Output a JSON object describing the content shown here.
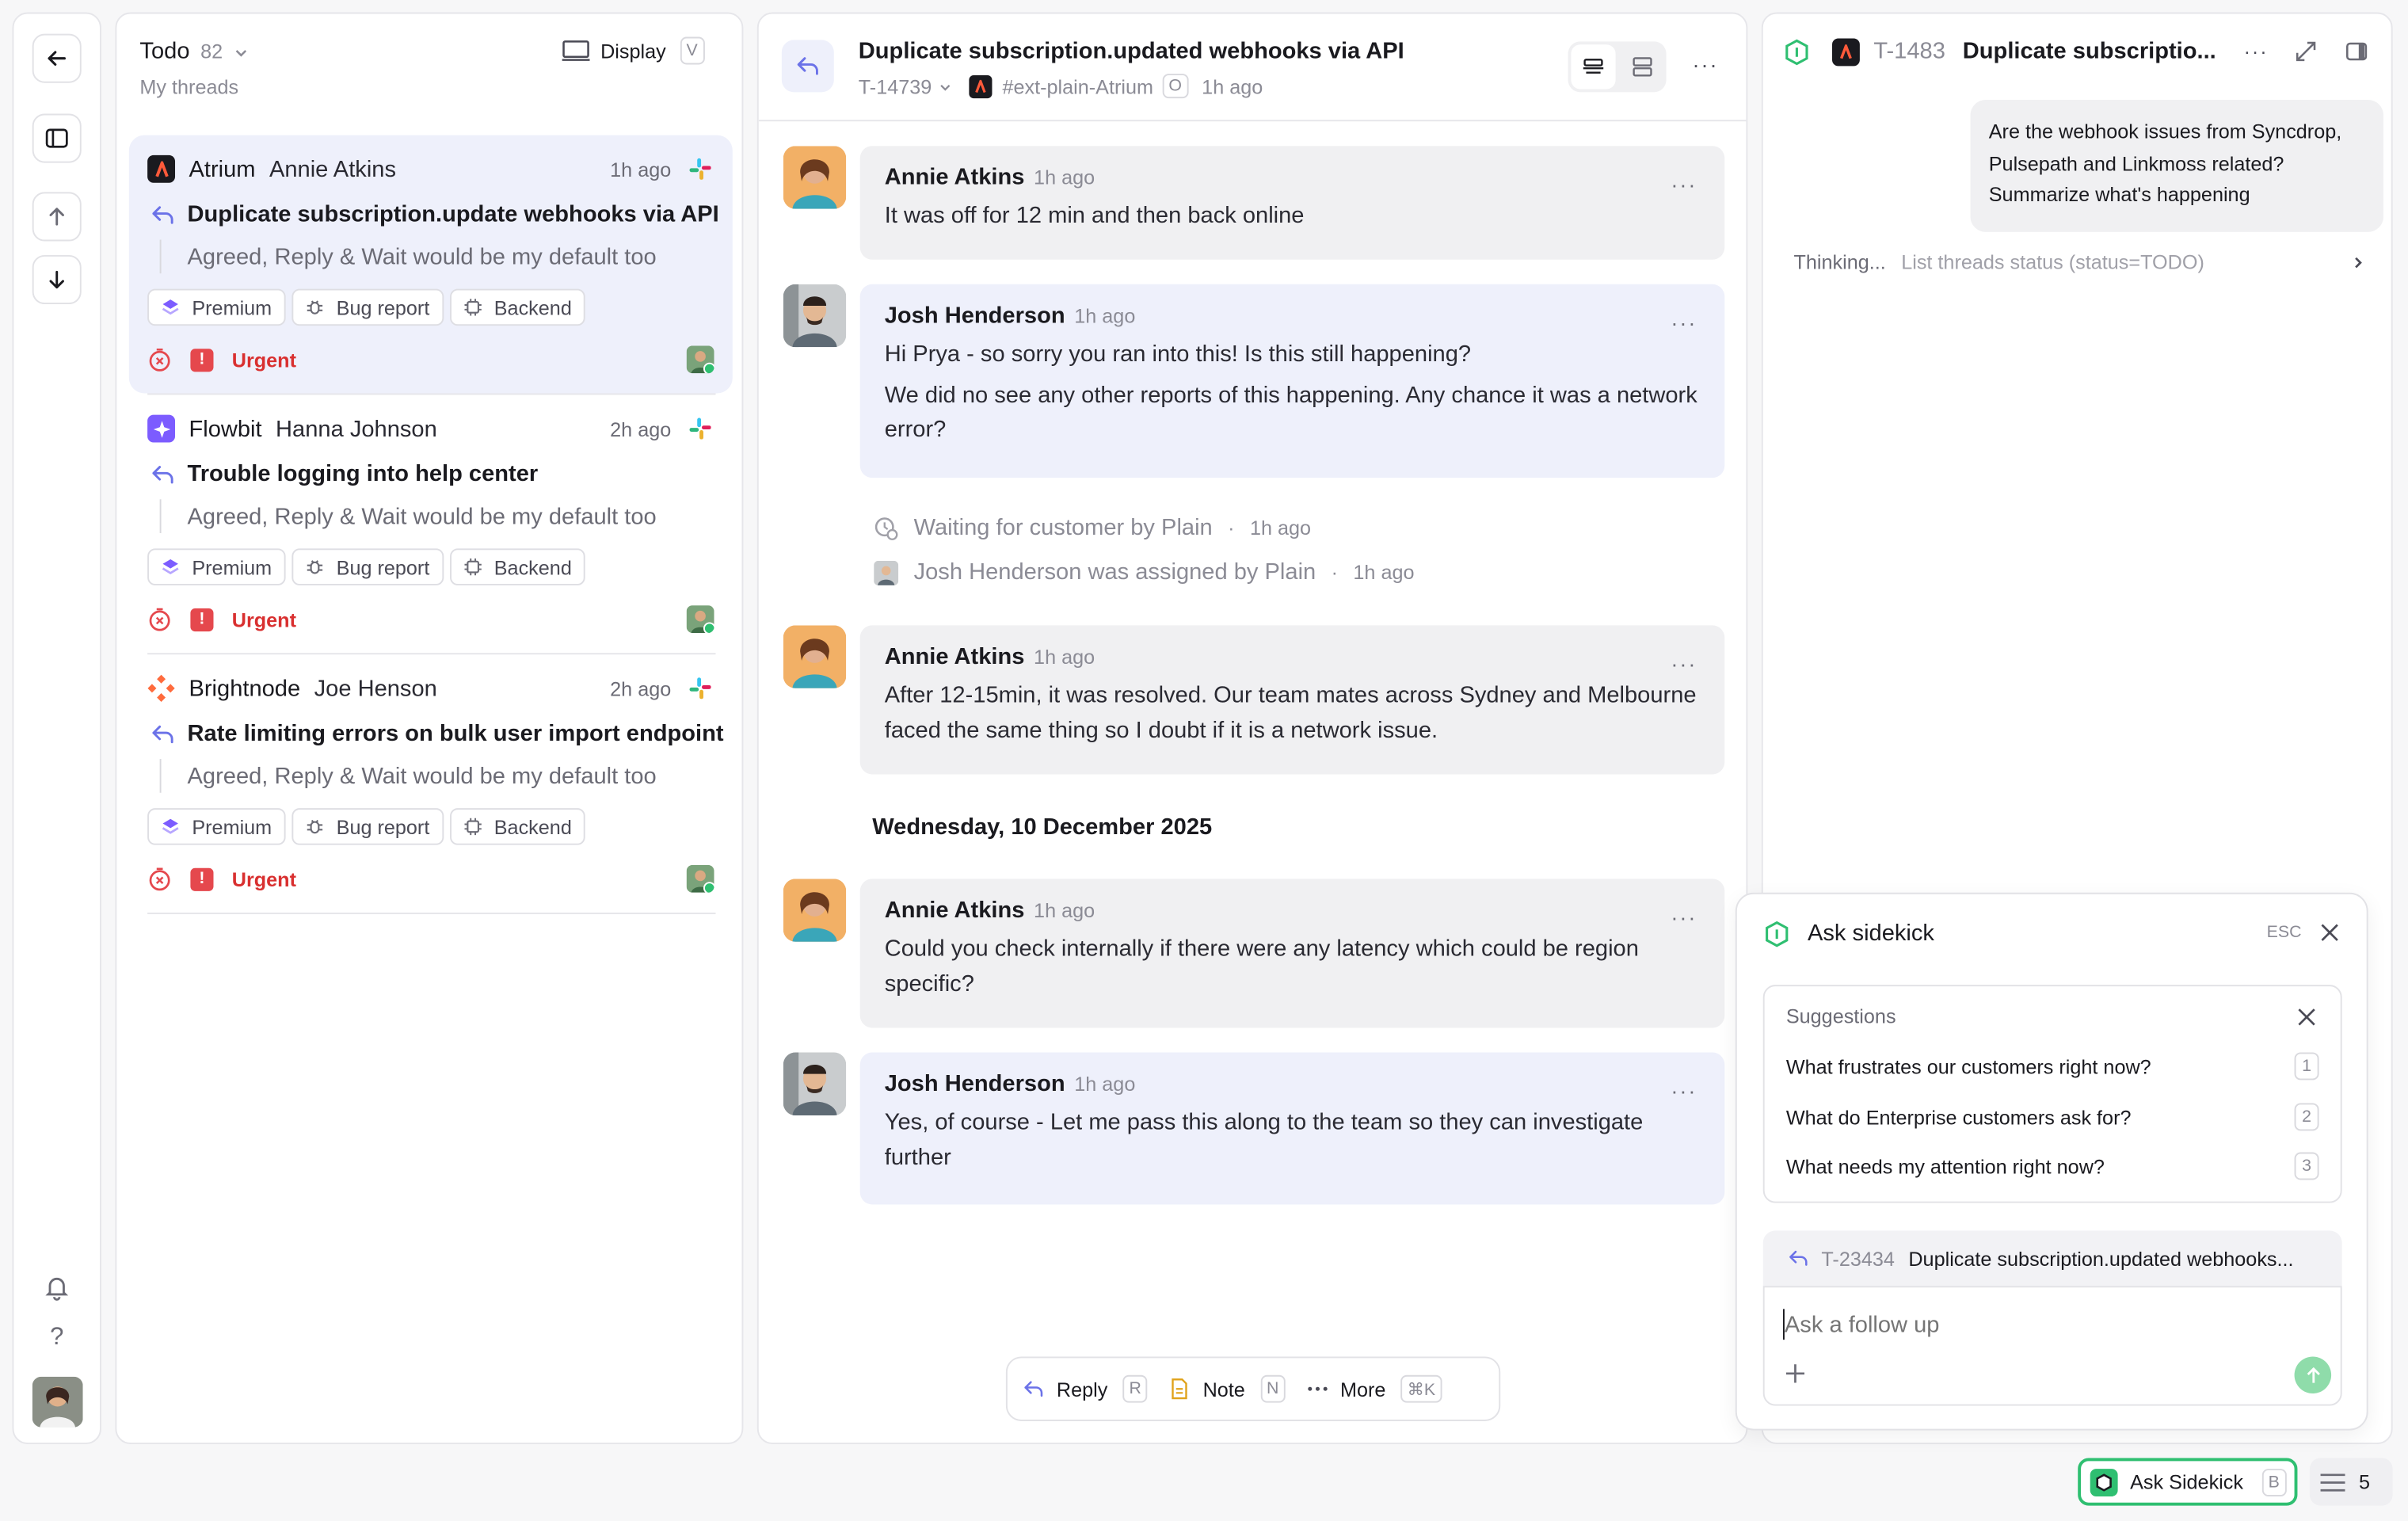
{
  "rail": {
    "back_icon": "arrow-left-icon",
    "layout_icon": "sidebar-icon",
    "up_icon": "arrow-up-icon",
    "down_icon": "arrow-down-icon",
    "help": "?"
  },
  "list": {
    "title": "Todo",
    "count": "82",
    "subtitle": "My threads",
    "display_label": "Display",
    "display_key": "V",
    "threads": [
      {
        "company": "Atrium",
        "person": "Annie Atkins",
        "time": "1h ago",
        "title": "Duplicate subscription.update webhooks via API",
        "preview": "Agreed, Reply & Wait would be my default too",
        "tags": [
          "Premium",
          "Bug report",
          "Backend"
        ],
        "priority": "Urgent",
        "priority_mark": "!"
      },
      {
        "company": "Flowbit",
        "person": "Hanna Johnson",
        "time": "2h ago",
        "title": "Trouble logging into help center",
        "preview": "Agreed, Reply & Wait would be my default too",
        "tags": [
          "Premium",
          "Bug report",
          "Backend"
        ],
        "priority": "Urgent",
        "priority_mark": "!"
      },
      {
        "company": "Brightnode",
        "person": "Joe Henson",
        "time": "2h ago",
        "title": "Rate limiting errors on bulk user import endpoint",
        "preview": "Agreed, Reply & Wait would be my default too",
        "tags": [
          "Premium",
          "Bug report",
          "Backend"
        ],
        "priority": "Urgent",
        "priority_mark": "!"
      }
    ]
  },
  "conversation": {
    "title": "Duplicate subscription.updated webhooks via API",
    "ticket": "T-14739",
    "channel": "#ext-plain-Atrium",
    "channel_badge": "O",
    "time": "1h ago",
    "more": "···",
    "messages": [
      {
        "author": "Annie Atkins",
        "time": "1h ago",
        "lines": [
          "It was off for 12 min and then back online"
        ]
      },
      {
        "author": "Josh Henderson",
        "time": "1h ago",
        "lines": [
          "Hi Prya - so sorry you ran into this! Is this still happening?",
          "We did no see any other reports of this happening. Any chance it was a network error?"
        ]
      },
      {
        "author": "Annie Atkins",
        "time": "1h ago",
        "lines": [
          "After 12-15min, it was resolved. Our team mates across Sydney and Melbourne faced the same thing so I doubt if it is a network issue."
        ]
      },
      {
        "author": "Annie Atkins",
        "time": "1h ago",
        "lines": [
          "Could you check internally if there were any latency which could be region specific?"
        ]
      },
      {
        "author": "Josh Henderson",
        "time": "1h ago",
        "lines": [
          "Yes, of course - Let me pass this along to the team so they can investigate further"
        ]
      }
    ],
    "events": [
      {
        "text": "Waiting for customer by Plain",
        "sep": "·",
        "time": "1h ago"
      },
      {
        "text": "Josh Henderson was assigned by Plain",
        "sep": "·",
        "time": "1h ago"
      }
    ],
    "date_divider": "Wednesday, 10 December 2025",
    "composer": {
      "reply": "Reply",
      "reply_key": "R",
      "note": "Note",
      "note_key": "N",
      "more": "More",
      "more_key": "⌘K"
    }
  },
  "sidekick": {
    "ticket": "T-1483",
    "title": "Duplicate subscriptio...",
    "question": "Are the webhook issues from Syncdrop, Pulsepath and Linkmoss related? Summarize what's happening",
    "thinking": "Thinking...",
    "thinking_detail": "List threads status (status=TODO)",
    "ask_title": "Ask sidekick",
    "esc": "ESC",
    "suggestions_title": "Suggestions",
    "suggestions": [
      {
        "text": "What frustrates our customers right now?",
        "key": "1"
      },
      {
        "text": "What do Enterprise customers ask for?",
        "key": "2"
      },
      {
        "text": "What needs my attention right now?",
        "key": "3"
      }
    ],
    "context_ticket": "T-23434",
    "context_title": "Duplicate subscription.updated webhooks...",
    "input_placeholder": "Ask a follow up",
    "ask_button": "Ask Sidekick",
    "ask_key": "B",
    "queue_count": "5"
  },
  "colors": {
    "accent": "#6b72e8",
    "urgent": "#e5484d",
    "sidekick_green": "#2fbf71",
    "active_bg": "#eef0fb"
  }
}
